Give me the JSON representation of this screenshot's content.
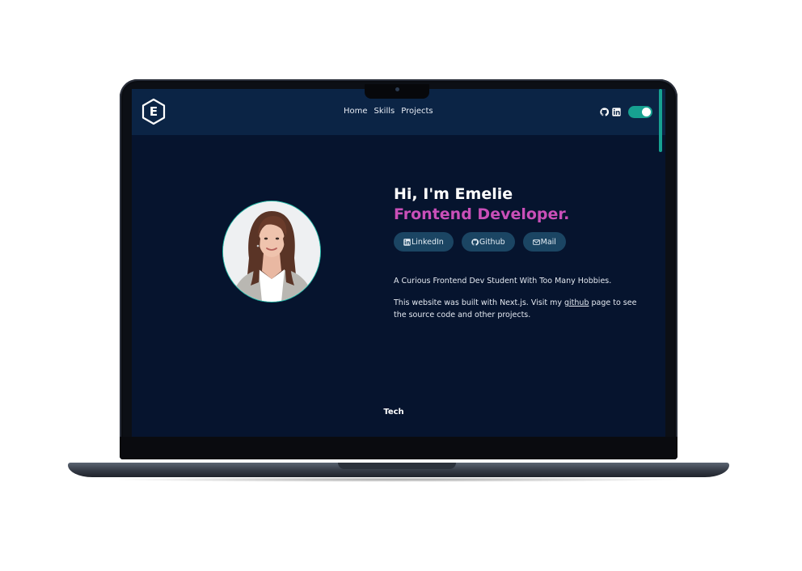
{
  "site": {
    "logo_letter": "E"
  },
  "nav": {
    "links": [
      {
        "label": "Home"
      },
      {
        "label": "Skills"
      },
      {
        "label": "Projects"
      }
    ],
    "icons": [
      "github-icon",
      "linkedin-icon"
    ],
    "theme_toggle_on": true
  },
  "hero": {
    "greeting": "Hi, I'm Emelie",
    "role": "Frontend Developer.",
    "buttons": [
      {
        "label": "LinkedIn",
        "icon": "linkedin-icon"
      },
      {
        "label": "Github",
        "icon": "github-icon"
      },
      {
        "label": "Mail",
        "icon": "mail-icon"
      }
    ],
    "tagline": "A Curious Frontend Dev Student With Too Many Hobbies.",
    "desc_before": "This website was built with Next.js. Visit my ",
    "desc_link": "github",
    "desc_after": " page to see the source code and other projects."
  },
  "section": {
    "tech_heading": "Tech"
  },
  "colors": {
    "background": "#06142e",
    "navbar": "#0b2445",
    "accent_teal": "#17a191",
    "accent_pink": "#c94fb8",
    "pill": "#1b4563"
  }
}
